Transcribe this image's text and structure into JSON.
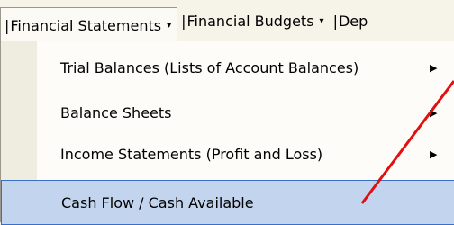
{
  "menubar": {
    "items": [
      {
        "label": "Financial Statements",
        "has_arrow": true,
        "active": true
      },
      {
        "label": "Financial Budgets",
        "has_arrow": true,
        "active": false
      },
      {
        "label": "Dep",
        "has_arrow": false,
        "active": false
      }
    ],
    "separator": "|",
    "arrow_glyph": "▾"
  },
  "dropdown": {
    "items": [
      {
        "label": "Trial Balances (Lists of Account Balances)",
        "has_submenu": true,
        "highlighted": false
      },
      {
        "label": "Balance Sheets",
        "has_submenu": true,
        "highlighted": false
      },
      {
        "label": "Income Statements (Profit and Loss)",
        "has_submenu": true,
        "highlighted": false
      },
      {
        "label": "Cash Flow / Cash Available",
        "has_submenu": false,
        "highlighted": true
      }
    ],
    "submenu_glyph": "▶"
  },
  "annotation": {
    "type": "arrow",
    "color": "#e01010"
  },
  "colors": {
    "highlight": "#c3d4ef",
    "highlight_border": "#3a6fc7"
  }
}
